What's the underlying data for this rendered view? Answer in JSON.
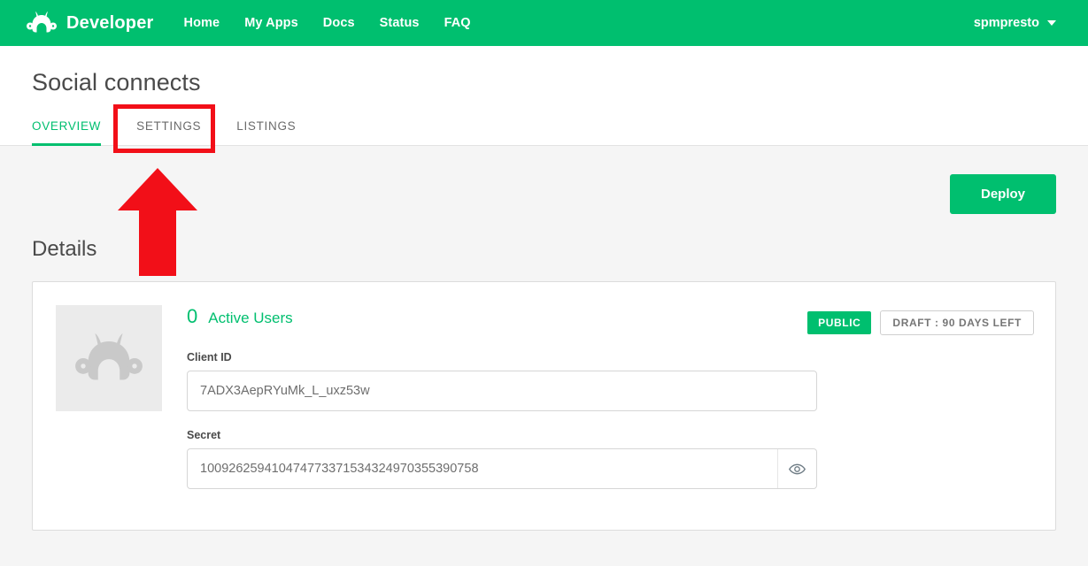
{
  "topnav": {
    "brand": "Developer",
    "logo_icon": "surveymonkey-logo-icon",
    "links": [
      {
        "label": "Home",
        "name": "nav-link-home"
      },
      {
        "label": "My Apps",
        "name": "nav-link-my-apps"
      },
      {
        "label": "Docs",
        "name": "nav-link-docs"
      },
      {
        "label": "Status",
        "name": "nav-link-status"
      },
      {
        "label": "FAQ",
        "name": "nav-link-faq"
      }
    ],
    "user": "spmpresto",
    "caret_icon": "chevron-down-icon",
    "bg_color": "#00bf6f"
  },
  "page": {
    "title": "Social connects"
  },
  "tabs": [
    {
      "label": "OVERVIEW",
      "active": true
    },
    {
      "label": "SETTINGS",
      "active": false
    },
    {
      "label": "LISTINGS",
      "active": false
    }
  ],
  "toolbar": {
    "deploy_label": "Deploy"
  },
  "details": {
    "section_title": "Details",
    "avatar_icon": "monkey-placeholder-icon",
    "active_users_count": "0",
    "active_users_label": "Active Users",
    "badge_public": "PUBLIC",
    "badge_draft": "DRAFT : 90 DAYS LEFT",
    "fields": {
      "client_id_label": "Client ID",
      "client_id_value": "7ADX3AepRYuMk_L_uxz53w",
      "secret_label": "Secret",
      "secret_value": "100926259410474773371534324970355390758",
      "secret_toggle_icon": "eye-icon"
    }
  },
  "annotations": {
    "highlight_color": "#f20f18",
    "box_target": "SETTINGS",
    "arrow_direction": "up"
  },
  "colors": {
    "brand_green": "#00bf6f",
    "page_bg": "#f5f5f5",
    "card_bg": "#ffffff"
  }
}
